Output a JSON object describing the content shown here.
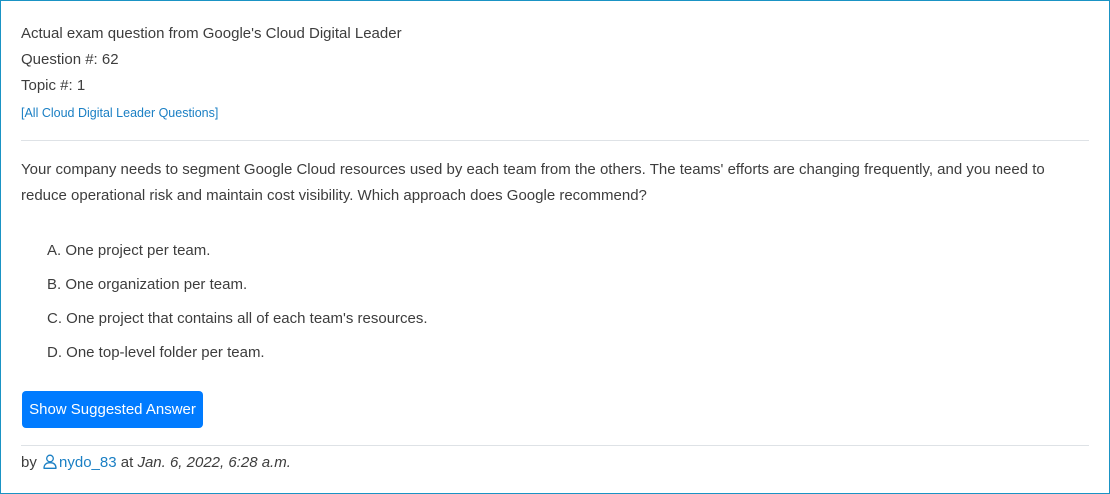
{
  "header": {
    "title": "Actual exam question from Google's Cloud Digital Leader",
    "question_number": "Question #: 62",
    "topic_number": "Topic #: 1",
    "all_questions_link": "[All Cloud Digital Leader Questions]"
  },
  "question": {
    "text": "Your company needs to segment Google Cloud resources used by each team from the others. The teams' efforts are changing frequently, and you need to reduce operational risk and maintain cost visibility. Which approach does Google recommend?"
  },
  "choices": [
    {
      "label": "A. One project per team."
    },
    {
      "label": "B. One organization per team."
    },
    {
      "label": "C. One project that contains all of each team's resources."
    },
    {
      "label": "D. One top-level folder per team."
    }
  ],
  "actions": {
    "show_answer_label": "Show Suggested Answer"
  },
  "footer": {
    "by_label": "by",
    "username": "nydo_83",
    "at_label": "at",
    "date": "Jan. 6, 2022, 6:28 a.m."
  },
  "colors": {
    "border": "#1a93c4",
    "link": "#1a7fc4",
    "button_bg": "#007bff",
    "button_text": "#ffffff"
  },
  "icons": {
    "user": "user-outline-icon"
  }
}
